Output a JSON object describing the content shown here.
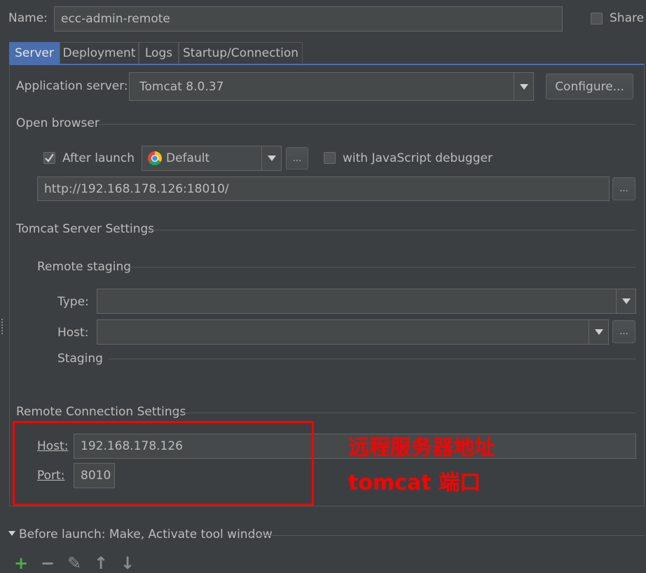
{
  "header": {
    "name_label": "Name:",
    "name_value": "ecc-admin-remote",
    "share_label": "Share"
  },
  "tabs": [
    {
      "label": "Server",
      "active": true
    },
    {
      "label": "Deployment"
    },
    {
      "label": "Logs"
    },
    {
      "label": "Startup/Connection"
    }
  ],
  "server": {
    "app_server_label": "Application server:",
    "app_server_value": "Tomcat 8.0.37",
    "configure_label": "Configure...",
    "open_browser_title": "Open browser",
    "after_launch_label": "After launch",
    "browser_value": "Default",
    "ellipsis": "...",
    "js_debugger_label": "with JavaScript debugger",
    "url_value": "http://192.168.178.126:18010/"
  },
  "tomcat": {
    "section_title": "Tomcat Server Settings",
    "remote_staging_title": "Remote staging",
    "type_label": "Type:",
    "host_label": "Host:",
    "staging_label": "Staging"
  },
  "remote": {
    "section_title": "Remote Connection Settings",
    "host_label": "Host:",
    "host_value": "192.168.178.126",
    "port_label": "Port:",
    "port_value": "8010"
  },
  "annotation": {
    "line1": "远程服务器地址",
    "line2": "tomcat 端口",
    "color": "#ff0000"
  },
  "before_launch": {
    "label": "Before launch: Make, Activate tool window"
  },
  "toolbar": {
    "add": "+",
    "remove": "−",
    "edit": "✎",
    "up": "↑",
    "down": "↓"
  },
  "colors": {
    "background": "#3c3f41",
    "tab_active": "#4b6eaf",
    "field": "#45494a",
    "text": "#bbbbbb"
  }
}
